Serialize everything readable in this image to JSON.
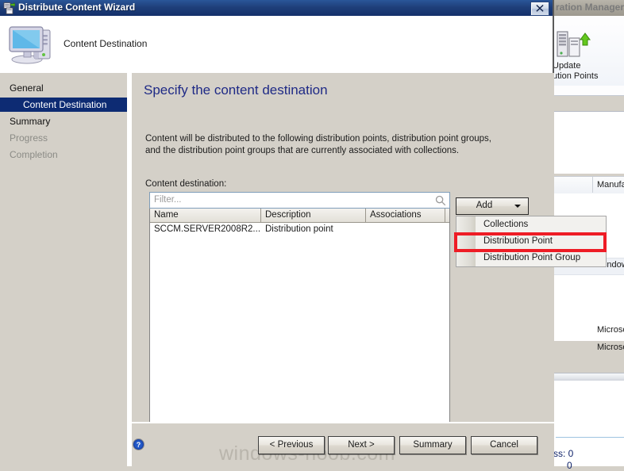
{
  "background_window": {
    "title": "ration Manager)",
    "ribbon_button": {
      "icon": "server-update-icon",
      "label_line1": "Update",
      "label_line2": "ution Points"
    },
    "column_header": "Manufac",
    "row_windows": "window",
    "rows_microsoft": [
      "Microso",
      "Microso"
    ],
    "status_text": "ss: 0",
    "status_text2": "0"
  },
  "wizard": {
    "titlebar": {
      "icon": "distribute-content-icon",
      "title": "Distribute Content Wizard",
      "close_label": "Close"
    },
    "header": {
      "icon": "computer-icon",
      "title": "Content Destination"
    },
    "sidebar": {
      "items": [
        {
          "label": "General",
          "state": "normal"
        },
        {
          "label": "Content Destination",
          "state": "selected"
        },
        {
          "label": "Summary",
          "state": "normal"
        },
        {
          "label": "Progress",
          "state": "disabled"
        },
        {
          "label": "Completion",
          "state": "disabled"
        }
      ]
    },
    "main": {
      "heading": "Specify the content destination",
      "description": "Content will be distributed to the following distribution points, distribution point groups, and the distribution point groups that are currently associated with collections.",
      "destination_label": "Content destination:",
      "filter": {
        "placeholder": "Filter...",
        "value": "",
        "icon": "search-icon"
      },
      "table": {
        "columns": [
          "Name",
          "Description",
          "Associations",
          ""
        ],
        "rows": [
          {
            "name": "SCCM.SERVER2008R2....",
            "description": "Distribution point",
            "associations": ""
          }
        ]
      },
      "add_button": {
        "label": "Add",
        "arrow_icon": "chevron-down-icon"
      },
      "add_menu": {
        "items": [
          {
            "label": "Collections",
            "highlighted": false
          },
          {
            "label": "Distribution Point",
            "highlighted": true
          },
          {
            "label": "Distribution Point Group",
            "highlighted": false
          }
        ],
        "highlight_color": "#ee1c25"
      }
    },
    "footer": {
      "help_icon": "help-icon",
      "buttons": [
        {
          "label": "< Previous"
        },
        {
          "label": "Next >"
        },
        {
          "label": "Summary"
        },
        {
          "label": "Cancel"
        }
      ]
    }
  },
  "watermark": "windows-noob.com",
  "colors": {
    "titlebar_blue": "#1f3f7a",
    "selection_blue": "#0d2b73",
    "heading_blue": "#1f2a86",
    "dialog_face": "#d4d0c8",
    "highlight_red": "#ee1c25"
  }
}
